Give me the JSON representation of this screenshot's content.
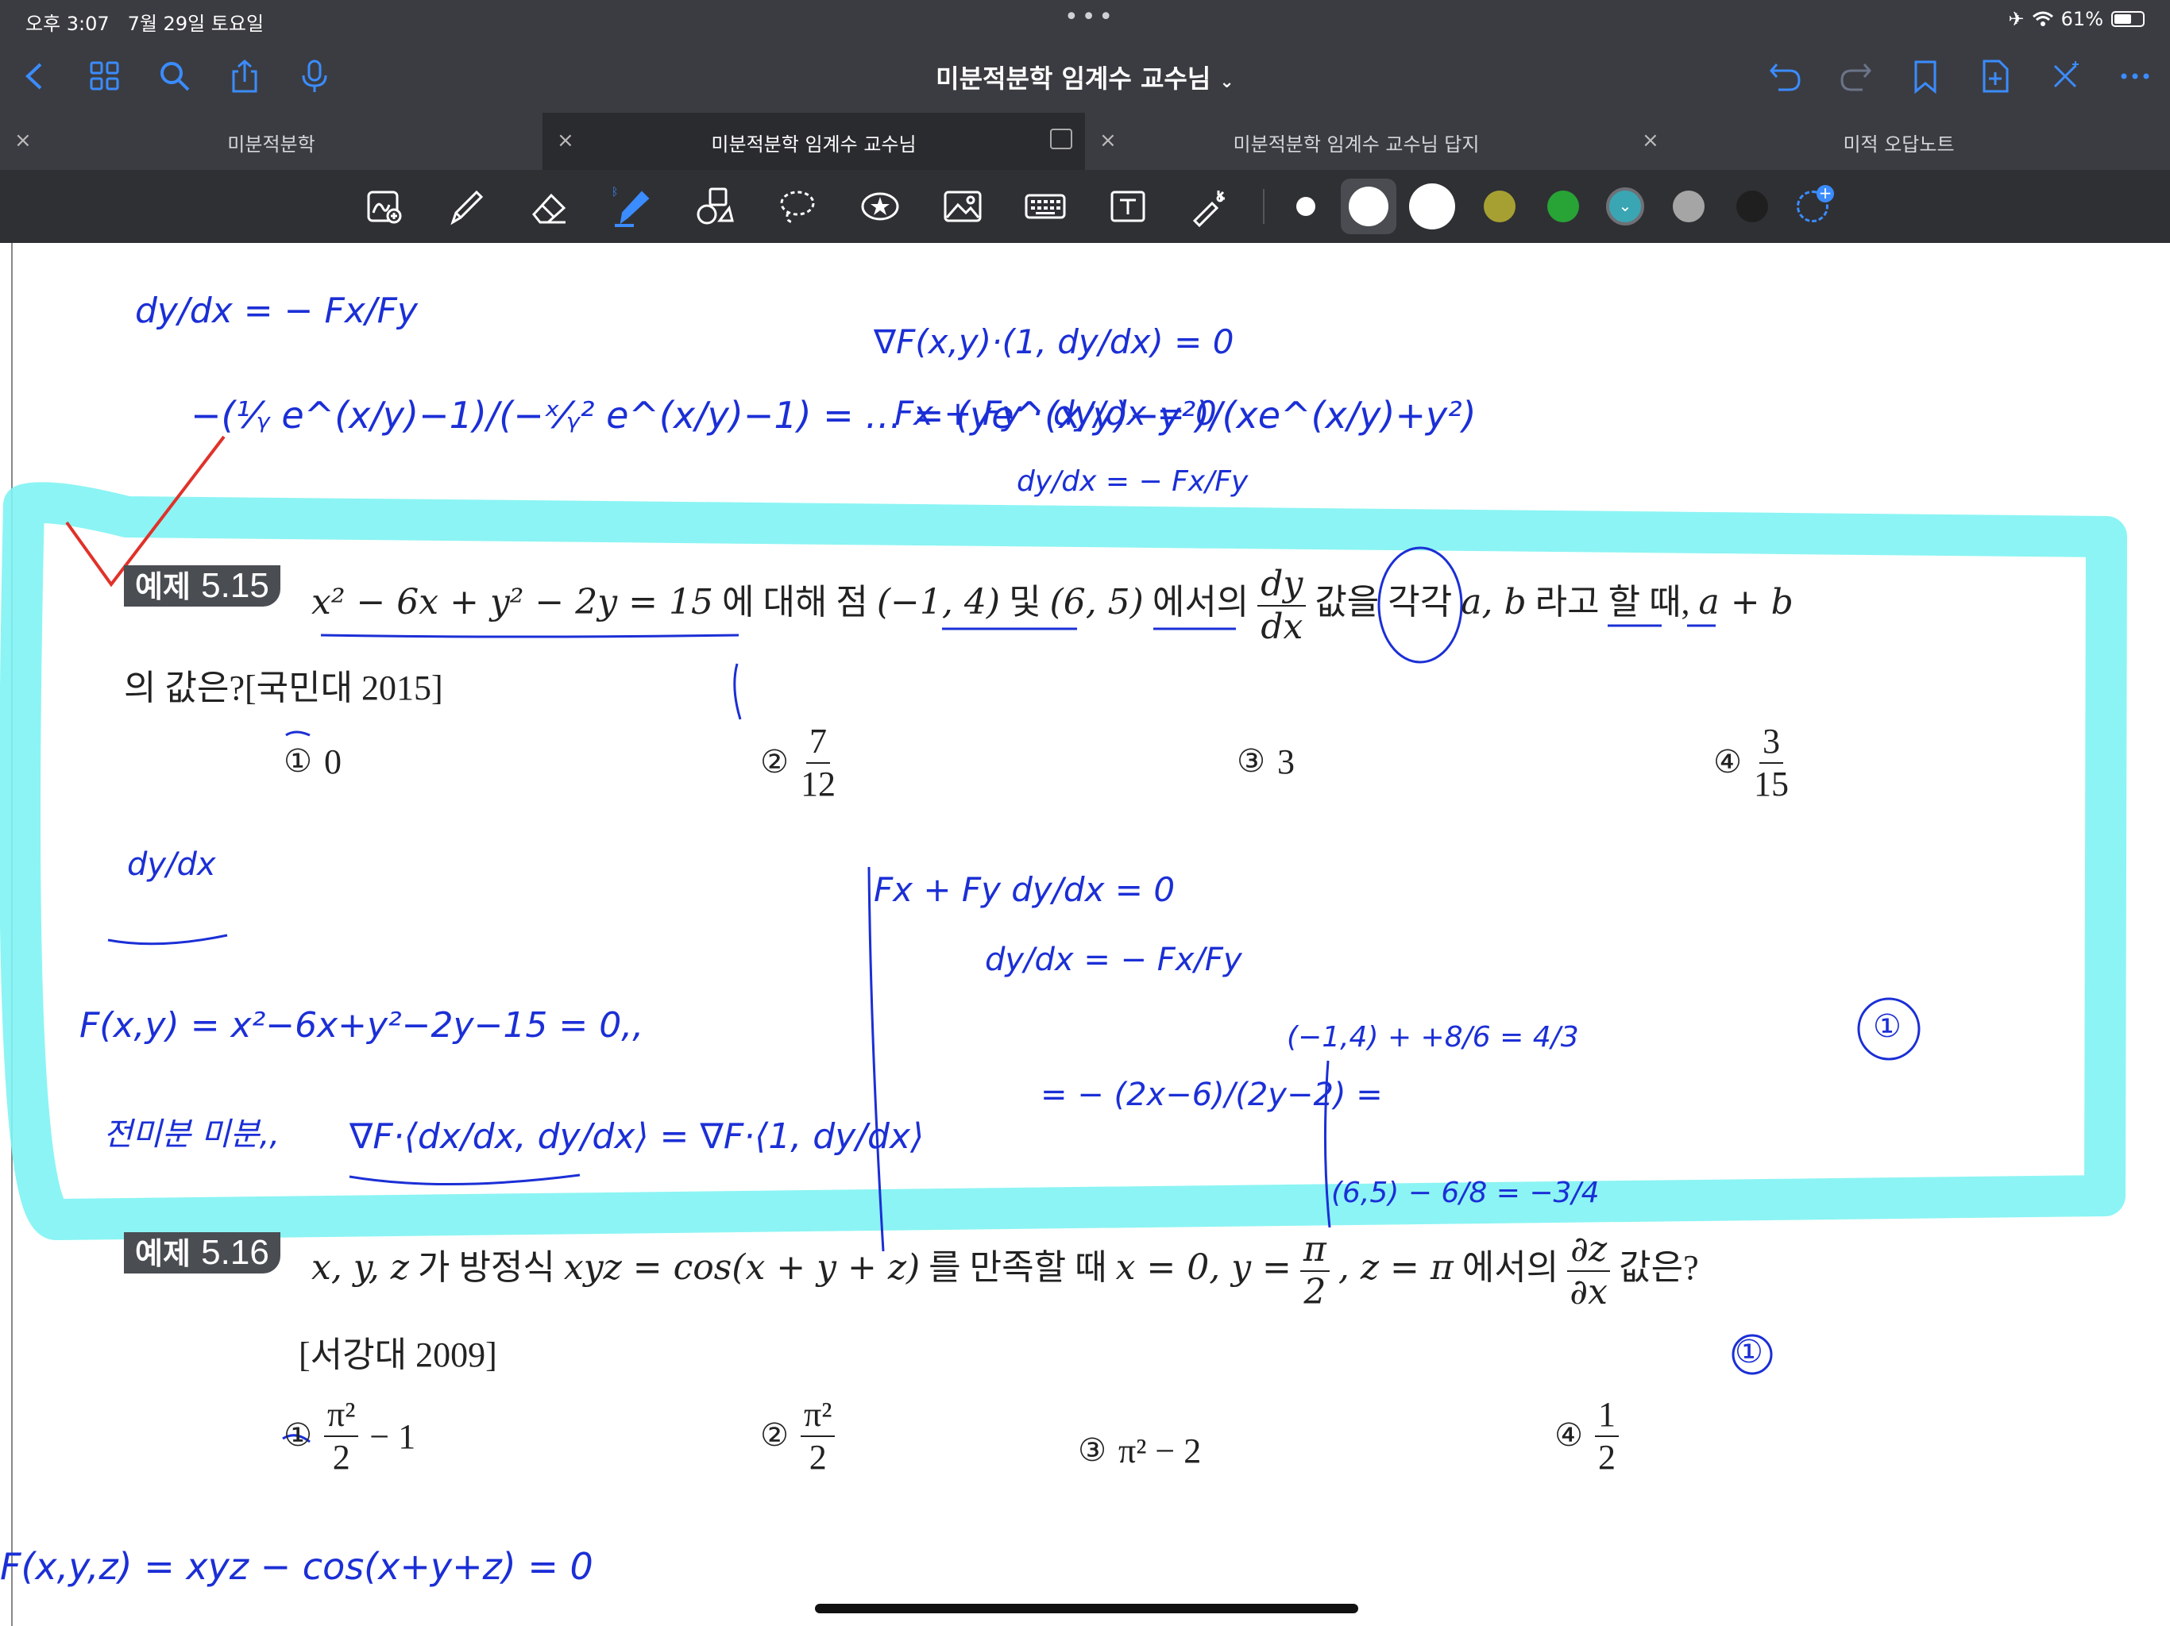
{
  "status": {
    "time": "오후 3:07",
    "date": "7월 29일 토요일",
    "battery": "61%",
    "battery_level": 0.61
  },
  "header": {
    "title": "미분적분학 임계수 교수님"
  },
  "tabs": [
    {
      "label": "미분적분학"
    },
    {
      "label": "미분적분학 임계수 교수님"
    },
    {
      "label": "미분적분학 임계수 교수님 답지"
    },
    {
      "label": "미적 오답노트"
    }
  ],
  "colors": {
    "highlight": "#7ff3f3",
    "ink": "#1b2fd6",
    "accent": "#3b8cff"
  },
  "toolbar": {
    "tools": [
      "scan-icon",
      "pen-icon",
      "eraser-icon",
      "highlighter-icon",
      "shapes-icon",
      "lasso-icon",
      "sticker-icon",
      "image-icon",
      "keyboard-icon",
      "text-icon",
      "laser-icon"
    ],
    "swatches": [
      "#ffffff",
      "#ffffff",
      "#ffffff",
      "#a6a032",
      "#28a335",
      "#3aa6b3",
      "#a5a5a5",
      "#1f1f1f"
    ]
  },
  "doc": {
    "q515": {
      "badge_word": "예제",
      "badge_num": "5.15",
      "line1_a": "x² − 6x + y² − 2y = 15",
      "line1_b": "에 대해 점",
      "line1_c": "(−1, 4)",
      "line1_d": "및",
      "line1_e": "(6, 5)",
      "line1_f": "에서의",
      "dydx_num": "dy",
      "dydx_den": "dx",
      "line1_g": "값을 각각",
      "line1_h": "a, b",
      "line1_i": "라고 할 때,",
      "line1_j": "a + b",
      "line2": "의 값은?[국민대 2015]",
      "choices": {
        "c1": "0",
        "c2_num": "7",
        "c2_den": "12",
        "c3": "3",
        "c4_num": "3",
        "c4_den": "15"
      }
    },
    "q516": {
      "badge_word": "예제",
      "badge_num": "5.16",
      "line1_a": "x, y, z",
      "line1_b": "가 방정식",
      "line1_c": "xyz = cos(x + y + z)",
      "line1_d": "를 만족할 때",
      "line1_e": "x = 0, y =",
      "pi_num": "π",
      "pi_den": "2",
      "line1_f": ", z = π",
      "line1_g": "에서의",
      "dzdx_num": "∂z",
      "dzdx_den": "∂x",
      "line1_h": "값은?",
      "line2": "[서강대 2009]",
      "choices": {
        "c1_num": "π²",
        "c1_den": "2",
        "c1_tail": "− 1",
        "c2_num": "π²",
        "c2_den": "2",
        "c3": "π² − 2",
        "c4_num": "1",
        "c4_den": "2"
      }
    }
  },
  "circled_nums": [
    "①",
    "②",
    "③",
    "④"
  ],
  "handwriting": {
    "h1": "dy/dx = − Fx/Fy",
    "h2": "∇F(x,y)·(1, dy/dx) = 0",
    "h3": "Fx + Fy · dy/dx = 0",
    "h4": "dy/dx = − Fx/Fy",
    "h5": "F(x,y) = x²−6x+y²−2y−15 = 0,,",
    "h6": "전미분 미분,,",
    "h7": "∇F·⟨dx/dx, dy/dx⟩ = ∇F·⟨1, dy/dx⟩",
    "h8": "Fx + Fy dy/dx = 0",
    "h9": "dy/dx = − Fx/Fy",
    "h10": "= − (2x−6)/(2y−2) =",
    "h11": "(−1,4)  + +8/6 = 4/3",
    "h12": "(6,5) − 6/8 = −3/4",
    "h13": "①",
    "h14": "①",
    "h15": "F(x,y,z) = xyz − cos(x+y+z) = 0",
    "h16": "dy/dx"
  }
}
